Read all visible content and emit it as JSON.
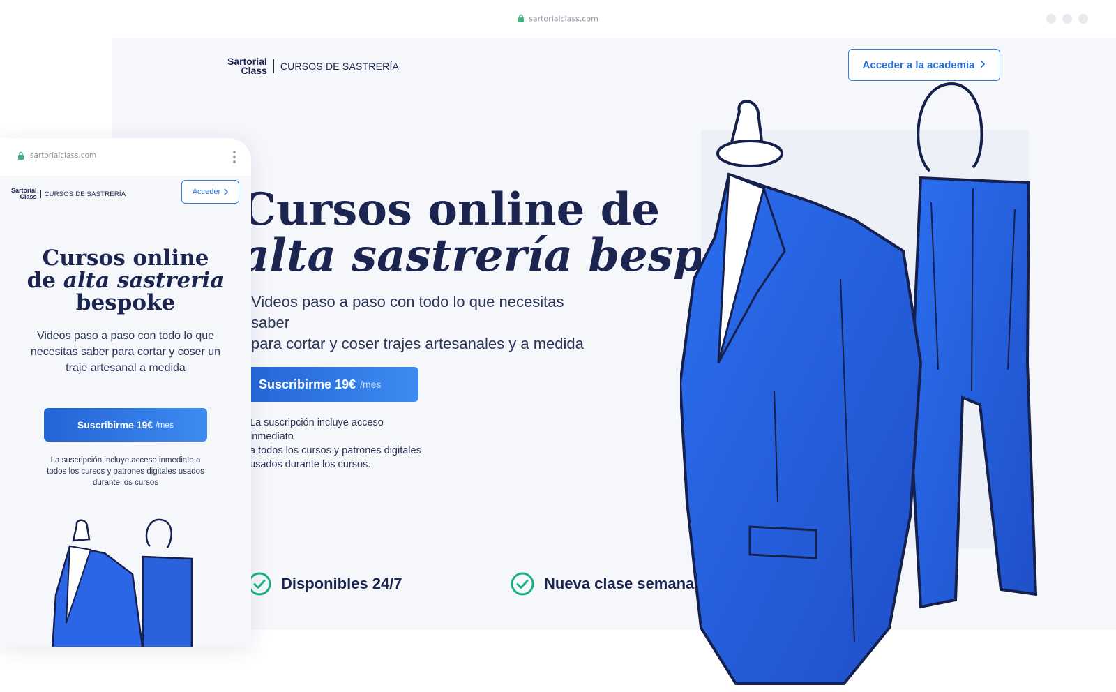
{
  "desktop": {
    "url": "sartorialclass.com",
    "logo": {
      "mark_line1": "Sartorial",
      "mark_line2": "Class",
      "tagline": "CURSOS DE SASTRERÍA"
    },
    "cta_label": "Acceder a la academia",
    "hero": {
      "title_line1": "Cursos online de",
      "title_line2": "alta sastrería bespoke",
      "subtitle_line1": "Videos paso a paso con todo lo que necesitas saber",
      "subtitle_line2": "para cortar y coser trajes artesanales y a medida"
    },
    "subscribe": {
      "label": "Suscribirme 19€",
      "period": "/mes"
    },
    "note_line1": "La suscripción incluye acceso inmediato",
    "note_line2": "a todos los cursos y  patrones digitales",
    "note_line3": "usados durante los cursos.",
    "features": [
      "Disponibles 24/7",
      "Nueva clase semanal"
    ]
  },
  "mobile": {
    "url": "sartorialclass.com",
    "logo": {
      "mark_line1": "Sartorial",
      "mark_line2": "Class",
      "tagline": "CURSOS DE SASTRERÍA"
    },
    "cta_label": "Acceder",
    "title_line1": "Cursos online",
    "title_line2_prefix": "de ",
    "title_line2_em": "alta sastreria",
    "title_line3": "bespoke",
    "subtitle": "Videos paso a paso con todo lo que necesitas saber para cortar y coser un traje artesanal a medida",
    "subscribe": {
      "label": "Suscribirme 19€",
      "period": "/mes"
    },
    "note": "La suscripción incluye acceso inmediato a todos los cursos y  patrones digitales usados durante los cursos"
  },
  "colors": {
    "brand_navy": "#1b2550",
    "accent_blue": "#2f7de8",
    "check_green": "#16b37c"
  }
}
